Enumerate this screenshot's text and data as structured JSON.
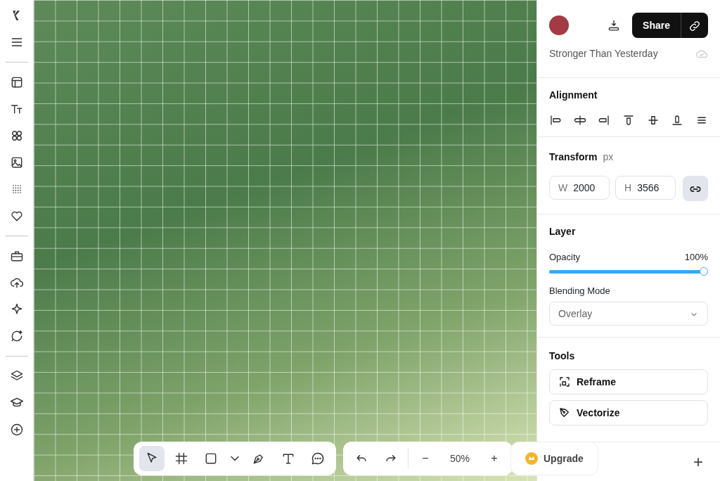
{
  "header": {
    "share_label": "Share",
    "project_title": "Stronger Than Yesterday"
  },
  "alignment": {
    "title": "Alignment",
    "actions": [
      {
        "kind": "left"
      },
      {
        "kind": "hcenter"
      },
      {
        "kind": "right"
      },
      {
        "kind": "top"
      },
      {
        "kind": "vcenter"
      },
      {
        "kind": "bottom"
      },
      {
        "kind": "more"
      }
    ]
  },
  "transform": {
    "title": "Transform",
    "unit": "px",
    "fields": [
      {
        "label": "W",
        "value": "2000"
      },
      {
        "label": "H",
        "value": "3566"
      }
    ],
    "ratio_locked": true
  },
  "layer": {
    "title": "Layer",
    "opacity": {
      "label": "Opacity",
      "reading": "100%",
      "level": 1.0
    },
    "blending": {
      "label": "Blending Mode",
      "value": "Overlay"
    }
  },
  "tools": {
    "title": "Tools",
    "items": [
      {
        "kind": "reframe",
        "label": "Reframe"
      },
      {
        "kind": "vectorize",
        "label": "Vectorize"
      }
    ]
  },
  "toolbar": {
    "tools": [
      {
        "kind": "select",
        "selected": true
      },
      {
        "kind": "frame",
        "selected": false
      },
      {
        "kind": "shape",
        "selected": false
      },
      {
        "kind": "pen",
        "selected": false
      },
      {
        "kind": "text",
        "selected": false
      },
      {
        "kind": "comment",
        "selected": false
      }
    ],
    "zoom_out": "−",
    "zoom": "50%",
    "zoom_in": "+",
    "upgrade": "Upgrade",
    "add": "+"
  }
}
